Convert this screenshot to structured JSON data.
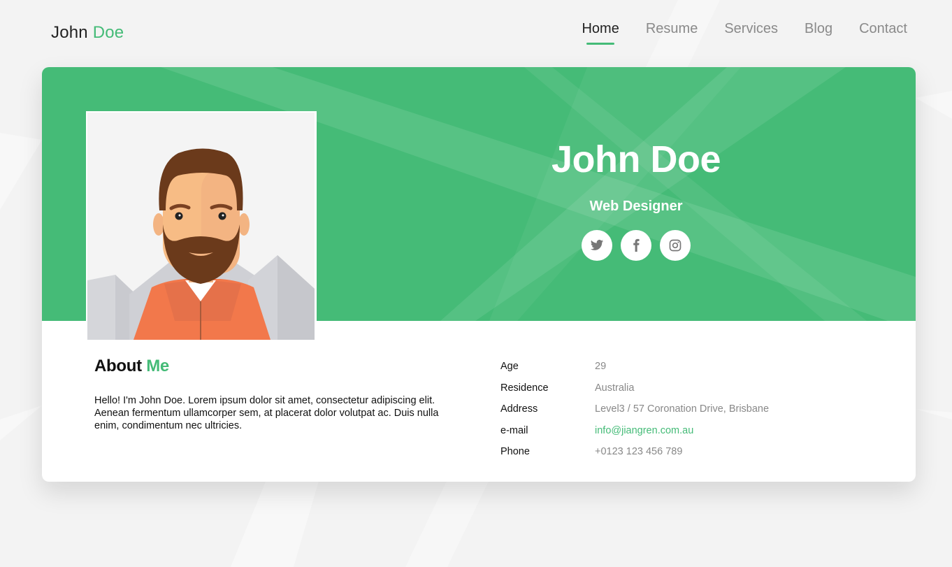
{
  "brand": {
    "first": "John",
    "last": "Doe"
  },
  "nav": {
    "items": [
      {
        "label": "Home",
        "active": true
      },
      {
        "label": "Resume",
        "active": false
      },
      {
        "label": "Services",
        "active": false
      },
      {
        "label": "Blog",
        "active": false
      },
      {
        "label": "Contact",
        "active": false
      }
    ]
  },
  "hero": {
    "name": "John Doe",
    "title": "Web Designer",
    "socials": [
      {
        "icon": "twitter-icon"
      },
      {
        "icon": "facebook-icon"
      },
      {
        "icon": "instagram-icon"
      }
    ]
  },
  "about": {
    "heading_main": "About",
    "heading_accent": "Me",
    "text": "Hello! I'm John Doe. Lorem ipsum dolor sit amet, consectetur adipiscing elit. Aenean fermentum ullamcorper sem, at placerat dolor volutpat ac. Duis nulla enim, condimentum nec ultricies."
  },
  "info": [
    {
      "label": "Age",
      "value": "29"
    },
    {
      "label": "Residence",
      "value": "Australia"
    },
    {
      "label": "Address",
      "value": "Level3 / 57 Coronation Drive, Brisbane"
    },
    {
      "label": "e-mail",
      "value": "info@jiangren.com.au"
    },
    {
      "label": "Phone",
      "value": "+0123 123 456 789"
    }
  ],
  "colors": {
    "accent": "#44bb77",
    "banner": "#45bb77",
    "background": "#f3f3f3",
    "muted_text": "#888888"
  }
}
